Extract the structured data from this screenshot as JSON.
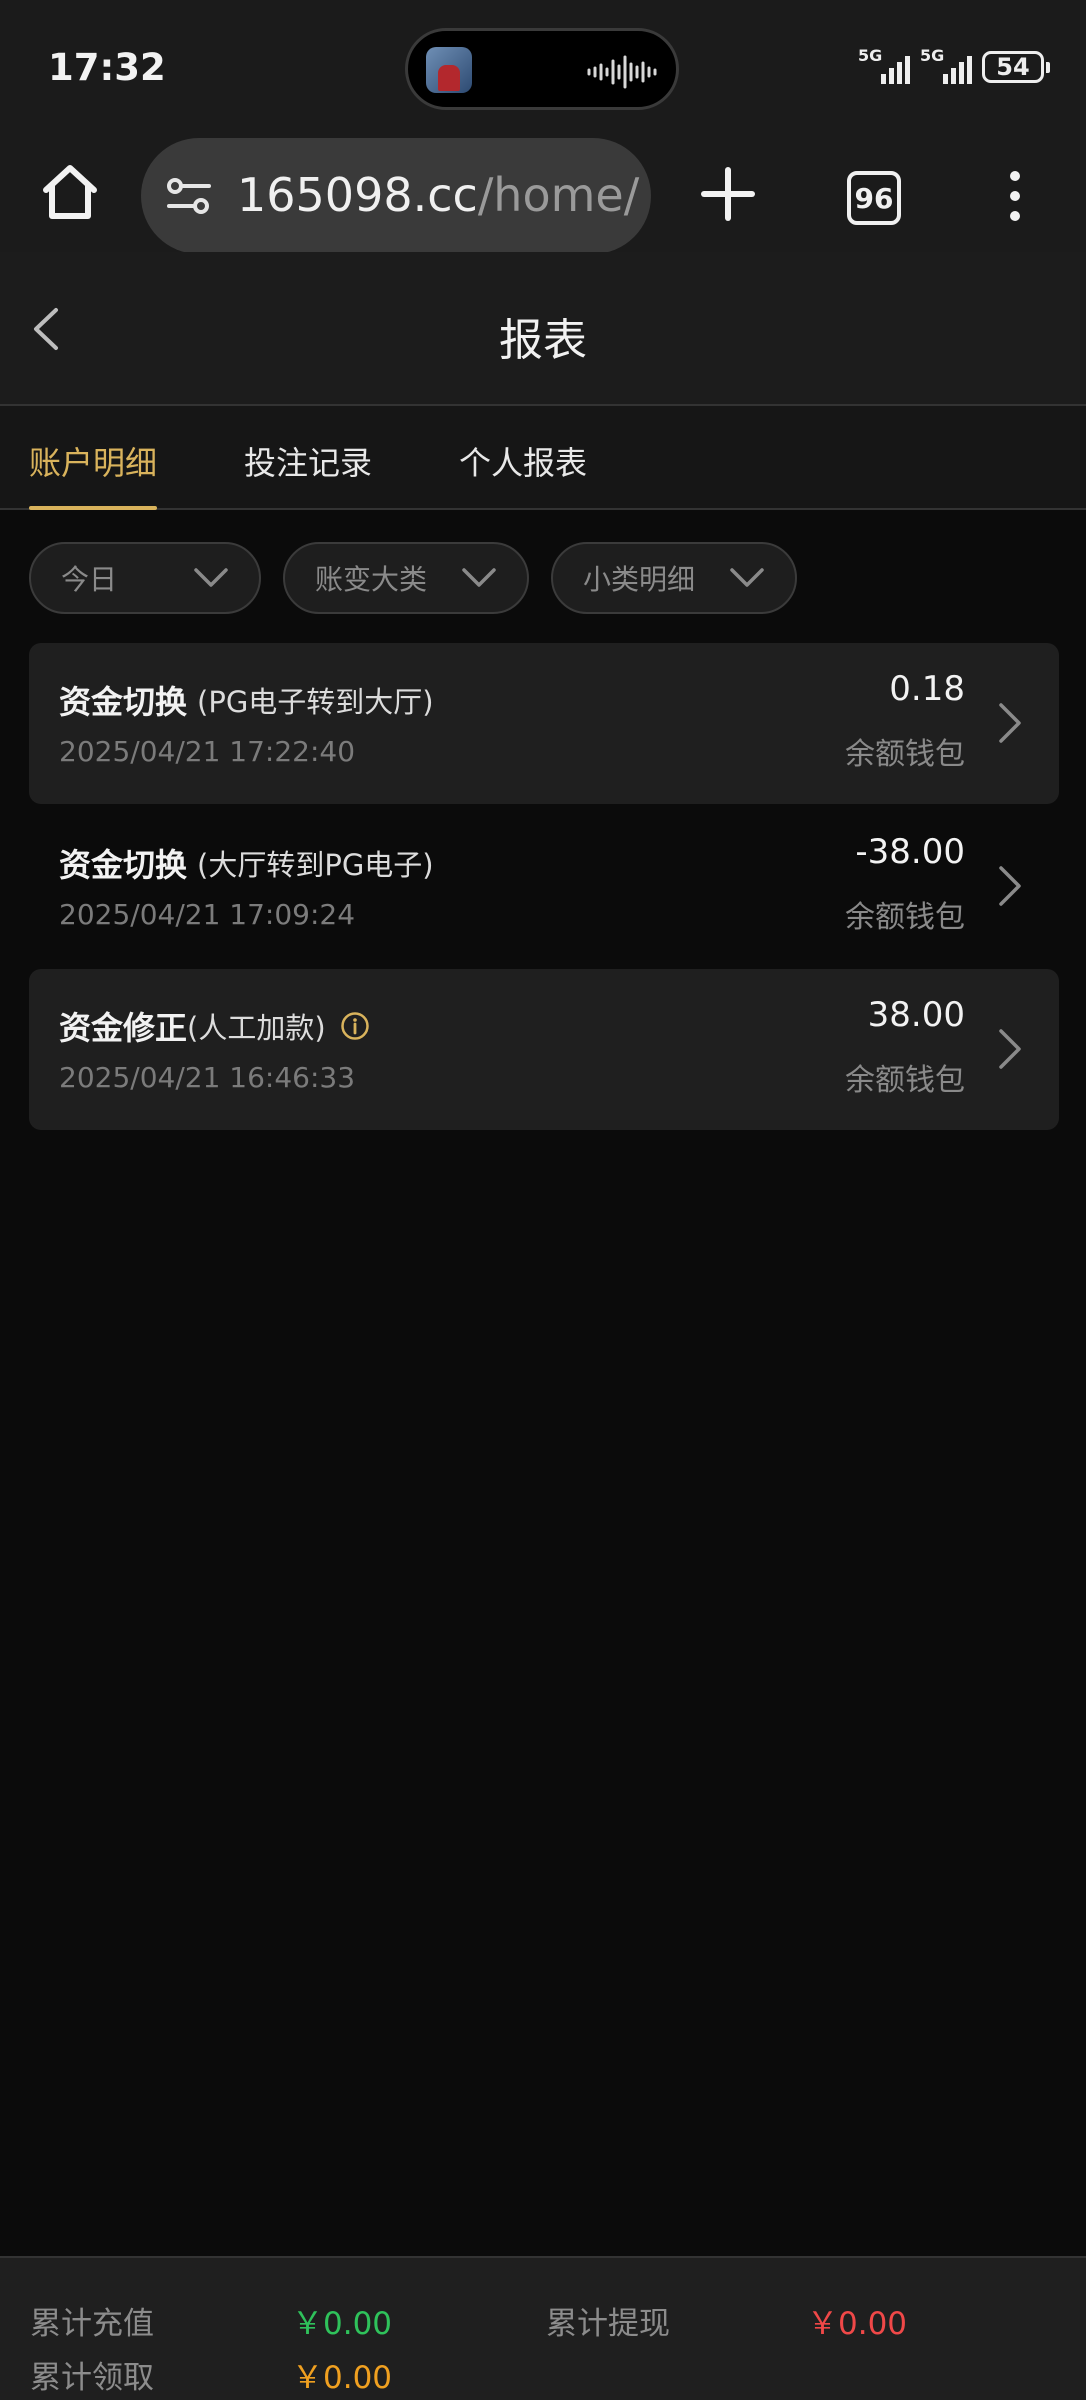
{
  "status_bar": {
    "time": "17:32",
    "battery": "54",
    "signal1": "5G",
    "signal2": "5G"
  },
  "browser": {
    "url_host": "165098.cc",
    "url_path": "/home/",
    "tab_count": "96"
  },
  "header": {
    "title": "报表"
  },
  "tabs": [
    {
      "label": "账户明细",
      "active": true
    },
    {
      "label": "投注记录",
      "active": false
    },
    {
      "label": "个人报表",
      "active": false
    }
  ],
  "filters": [
    {
      "label": "今日"
    },
    {
      "label": "账变大类"
    },
    {
      "label": "小类明细"
    }
  ],
  "records": [
    {
      "title": "资金切换",
      "detail": "(PG电子转到大厅)",
      "date": "2025/04/21 17:22:40",
      "amount": "0.18",
      "wallet": "余额钱包"
    },
    {
      "title": "资金切换",
      "detail": "(大厅转到PG电子)",
      "date": "2025/04/21 17:09:24",
      "amount": "-38.00",
      "wallet": "余额钱包"
    },
    {
      "title": "资金修正",
      "detail": "(人工加款)",
      "date": "2025/04/21 16:46:33",
      "amount": "38.00",
      "wallet": "余额钱包"
    }
  ],
  "summary": {
    "recharge_label": "累计充值",
    "recharge_value": "￥0.00",
    "withdraw_label": "累计提现",
    "withdraw_value": "￥0.00",
    "claim_label": "累计领取",
    "claim_value": "￥0.00"
  },
  "colors": {
    "accent": "#d9b35c",
    "recharge": "#2fc25b",
    "withdraw": "#f04848",
    "claim": "#f0a020",
    "info_icon": "#d9b35c"
  }
}
